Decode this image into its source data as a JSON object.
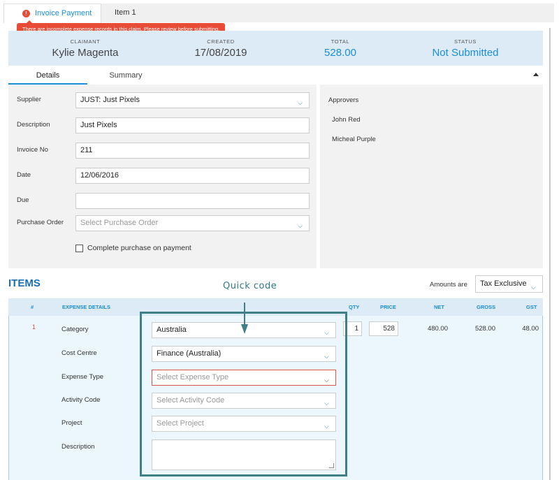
{
  "tabs": {
    "active_label": "Invoice Payment",
    "alert_glyph": "!",
    "item_label": "Item 1"
  },
  "warning": "There are incomplete expense records in this claim. Please review before submitting.",
  "summary": {
    "claimant_label": "CLAIMANT",
    "claimant": "Kylie Magenta",
    "created_label": "CREATED",
    "created": "17/08/2019",
    "total_label": "TOTAL",
    "total": "528.00",
    "status_label": "STATUS",
    "status": "Not Submitted"
  },
  "subtabs": {
    "details": "Details",
    "summary": "Summary"
  },
  "details": {
    "supplier_label": "Supplier",
    "supplier": "JUST: Just Pixels",
    "description_label": "Description",
    "description": "Just Pixels",
    "invoice_label": "Invoice No",
    "invoice": "211",
    "date_label": "Date",
    "date": "12/06/2016",
    "due_label": "Due",
    "due": "",
    "po_label": "Purchase Order",
    "po_placeholder": "Select Purchase Order",
    "complete_label": "Complete purchase on payment"
  },
  "approvers": {
    "title": "Approvers",
    "names": [
      "John Red",
      "Micheal Purple"
    ]
  },
  "items": {
    "title": "ITEMS",
    "quick_code": "Quick code",
    "amounts_label": "Amounts are",
    "amounts_value": "Tax Exclusive",
    "headers": {
      "num": "#",
      "expense": "EXPENSE DETAILS",
      "qty": "QTY",
      "price": "PRICE",
      "net": "NET",
      "gross": "GROSS",
      "gst": "GST"
    },
    "row": {
      "num": "1",
      "category_label": "Category",
      "category": "Australia",
      "cost_centre_label": "Cost Centre",
      "cost_centre": "Finance (Australia)",
      "expense_type_label": "Expense Type",
      "expense_type_placeholder": "Select Expense Type",
      "activity_label": "Activity Code",
      "activity_placeholder": "Select Activity Code",
      "project_label": "Project",
      "project_placeholder": "Select Project",
      "description_label": "Description",
      "qty": "1",
      "price": "528",
      "net": "480.00",
      "gross": "528.00",
      "gst": "48.00"
    }
  },
  "colors": {
    "accent": "#1a8ed6",
    "alert": "#e84b36",
    "highlight": "#3f7f86",
    "header_bg": "#ddebf7"
  }
}
